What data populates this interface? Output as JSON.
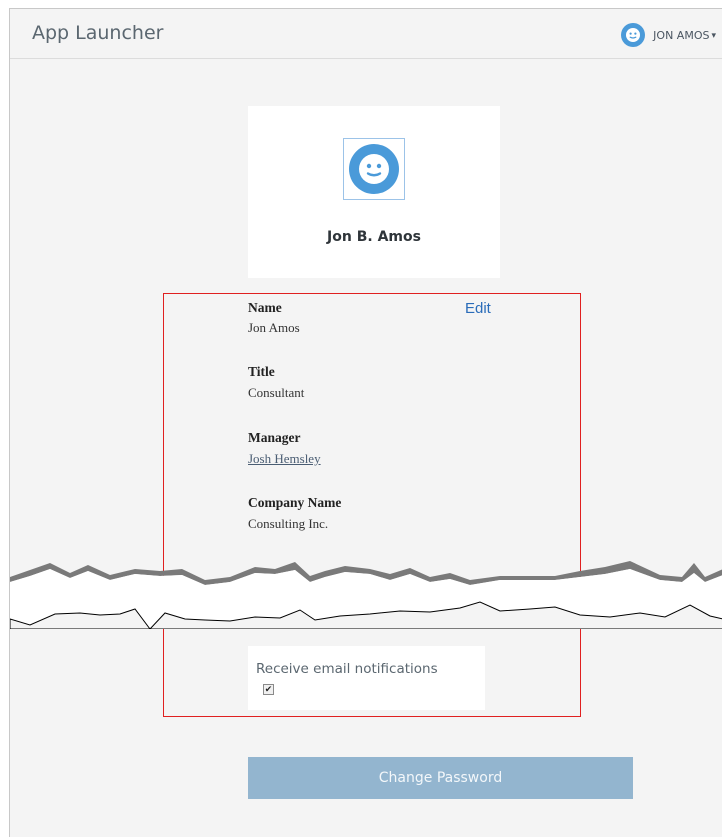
{
  "header": {
    "app_title": "App Launcher",
    "user_name": "JON AMOS",
    "caret": "▾"
  },
  "profile": {
    "full_name": "Jon B. Amos"
  },
  "fields": {
    "edit_label": "Edit",
    "name_label": "Name",
    "name_value": "Jon Amos",
    "title_label": "Title",
    "title_value": "Consultant",
    "manager_label": "Manager",
    "manager_value": "Josh Hemsley",
    "company_label": "Company Name",
    "company_value": "Consulting Inc."
  },
  "notifications": {
    "label": "Receive email notifications",
    "checked": true,
    "check_glyph": "✔"
  },
  "actions": {
    "change_password_label": "Change Password"
  },
  "colors": {
    "accent": "#4a9ad9",
    "link": "#2a6cb9",
    "button": "#93b5cf",
    "highlight": "#e02020"
  },
  "icons": {
    "avatar": "smiley-face-icon"
  }
}
